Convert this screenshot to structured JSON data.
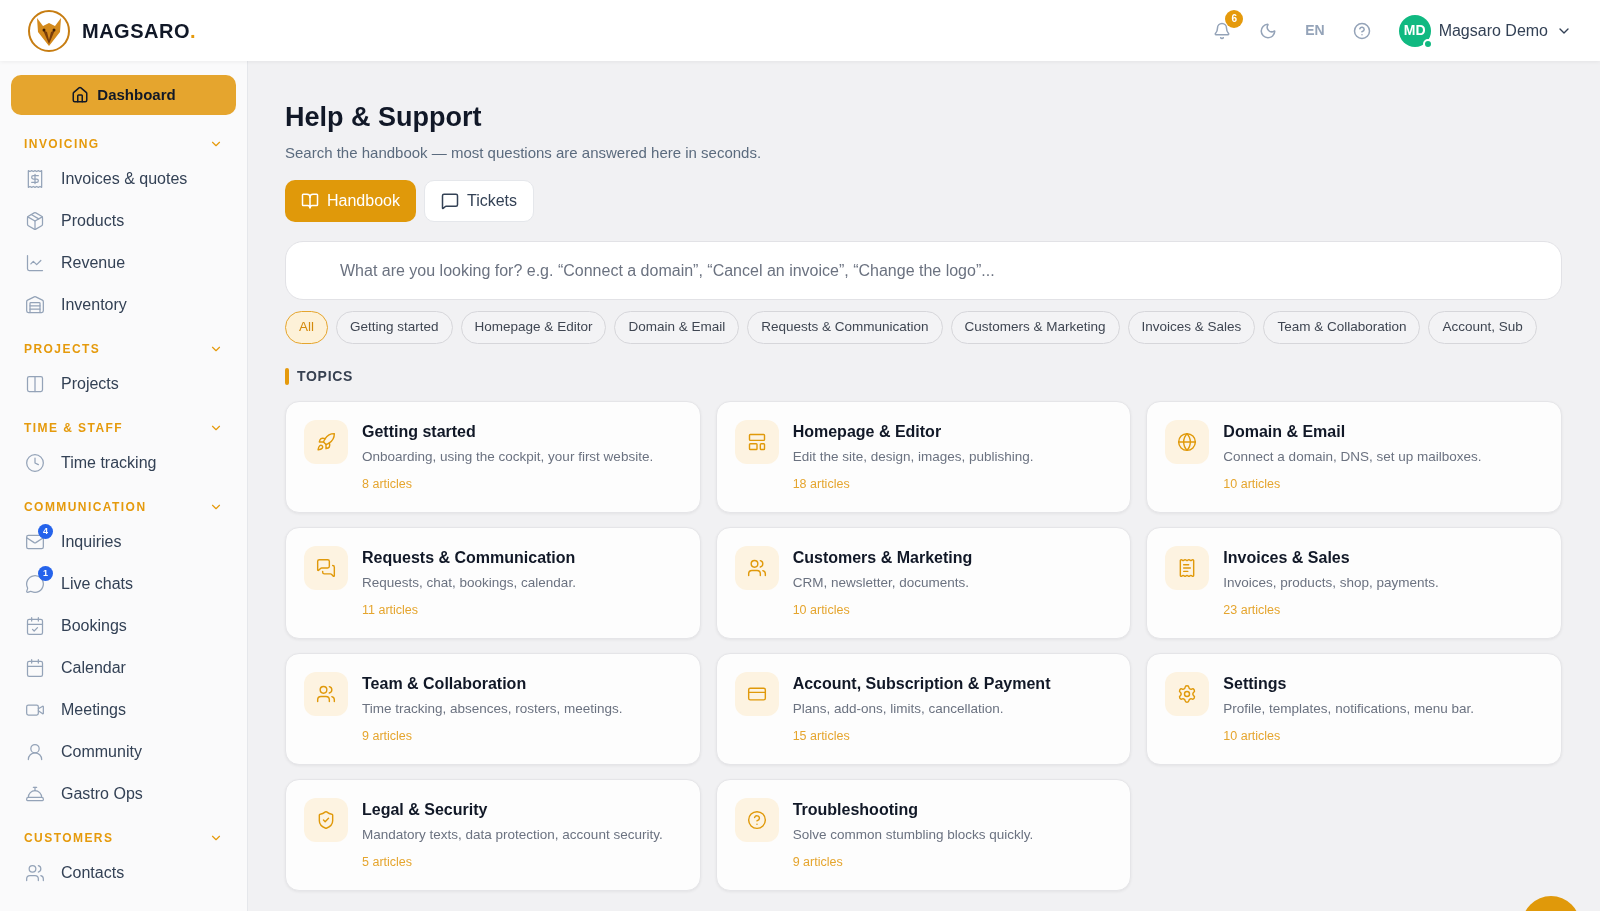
{
  "header": {
    "brand": "MAGSARO",
    "brand_mark": ".",
    "notification_count": "6",
    "language": "EN",
    "user": {
      "initials": "MD",
      "name": "Magsaro Demo",
      "online": true
    }
  },
  "sidebar": {
    "dashboard": {
      "label": "Dashboard",
      "selected": true
    },
    "sections": [
      {
        "title": "INVOICING",
        "expanded": true,
        "items": [
          {
            "label": "Invoices & quotes"
          },
          {
            "label": "Products"
          },
          {
            "label": "Revenue"
          },
          {
            "label": "Inventory"
          }
        ]
      },
      {
        "title": "PROJECTS",
        "expanded": true,
        "items": [
          {
            "label": "Projects"
          }
        ]
      },
      {
        "title": "TIME & STAFF",
        "expanded": true,
        "items": [
          {
            "label": "Time tracking"
          }
        ]
      },
      {
        "title": "COMMUNICATION",
        "expanded": true,
        "items": [
          {
            "label": "Inquiries",
            "badge": "4"
          },
          {
            "label": "Live chats",
            "badge": "1"
          },
          {
            "label": "Bookings"
          },
          {
            "label": "Calendar"
          },
          {
            "label": "Meetings"
          },
          {
            "label": "Community"
          },
          {
            "label": "Gastro Ops"
          }
        ]
      },
      {
        "title": "CUSTOMERS",
        "expanded": true,
        "items": [
          {
            "label": "Contacts"
          }
        ]
      }
    ]
  },
  "page": {
    "title": "Help & Support",
    "subtitle": "Search the handbook — most questions are answered here in seconds.",
    "tabs": [
      {
        "label": "Handbook",
        "selected": true
      },
      {
        "label": "Tickets",
        "selected": false
      }
    ],
    "search": {
      "placeholder": "What are you looking for? e.g. “Connect a domain”, “Cancel an invoice”, “Change the logo”..."
    },
    "filters": [
      {
        "label": "All",
        "selected": true
      },
      {
        "label": "Getting started",
        "selected": false
      },
      {
        "label": "Homepage & Editor",
        "selected": false
      },
      {
        "label": "Domain & Email",
        "selected": false
      },
      {
        "label": "Requests & Communication",
        "selected": false
      },
      {
        "label": "Customers & Marketing",
        "selected": false
      },
      {
        "label": "Invoices & Sales",
        "selected": false
      },
      {
        "label": "Team & Collaboration",
        "selected": false
      },
      {
        "label": "Account, Sub",
        "selected": false
      }
    ],
    "section_title": "TOPICS",
    "topics": [
      {
        "title": "Getting started",
        "description": "Onboarding, using the cockpit, your first website.",
        "count": "8 articles"
      },
      {
        "title": "Homepage & Editor",
        "description": "Edit the site, design, images, publishing.",
        "count": "18 articles"
      },
      {
        "title": "Domain & Email",
        "description": "Connect a domain, DNS, set up mailboxes.",
        "count": "10 articles"
      },
      {
        "title": "Requests & Communication",
        "description": "Requests, chat, bookings, calendar.",
        "count": "11 articles"
      },
      {
        "title": "Customers & Marketing",
        "description": "CRM, newsletter, documents.",
        "count": "10 articles"
      },
      {
        "title": "Invoices & Sales",
        "description": "Invoices, products, shop, payments.",
        "count": "23 articles"
      },
      {
        "title": "Team & Collaboration",
        "description": "Time tracking, absences, rosters, meetings.",
        "count": "9 articles"
      },
      {
        "title": "Account, Subscription & Payment",
        "description": "Plans, add-ons, limits, cancellation.",
        "count": "15 articles"
      },
      {
        "title": "Settings",
        "description": "Profile, templates, notifications, menu bar.",
        "count": "10 articles"
      },
      {
        "title": "Legal & Security",
        "description": "Mandatory texts, data protection, account security.",
        "count": "5 articles"
      },
      {
        "title": "Troubleshooting",
        "description": "Solve common stumbling blocks quickly.",
        "count": "9 articles"
      }
    ]
  }
}
